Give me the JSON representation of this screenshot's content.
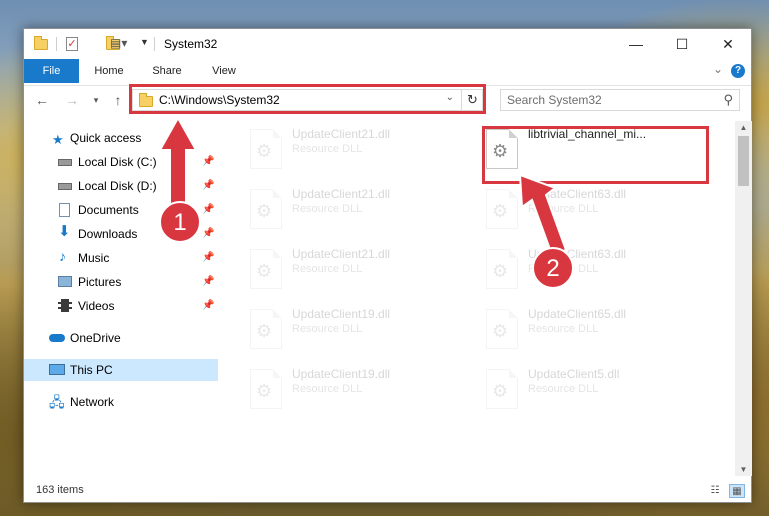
{
  "window": {
    "title": "System32",
    "min_glyph": "—",
    "max_glyph": "☐",
    "close_glyph": "✕"
  },
  "ribbon": {
    "tabs": [
      "File",
      "Home",
      "Share",
      "View"
    ],
    "help_glyph": "?",
    "collapse_glyph": "⌄"
  },
  "address": {
    "path": "C:\\Windows\\System32",
    "search_placeholder": "Search System32"
  },
  "navpane": {
    "items": [
      {
        "label": "Quick access",
        "icon": "star-icon"
      },
      {
        "label": "Local Disk (C:)",
        "icon": "drive-icon",
        "pinned": true
      },
      {
        "label": "Local Disk (D:)",
        "icon": "drive-icon",
        "pinned": true
      },
      {
        "label": "Documents",
        "icon": "documents-icon",
        "pinned": true
      },
      {
        "label": "Downloads",
        "icon": "downloads-icon",
        "pinned": true
      },
      {
        "label": "Music",
        "icon": "music-icon",
        "pinned": true
      },
      {
        "label": "Pictures",
        "icon": "pictures-icon",
        "pinned": true
      },
      {
        "label": "Videos",
        "icon": "videos-icon",
        "pinned": true
      },
      {
        "label": "OneDrive",
        "icon": "cloud-icon"
      },
      {
        "label": "This PC",
        "icon": "computer-icon",
        "selected": true
      },
      {
        "label": "Network",
        "icon": "network-icon"
      }
    ]
  },
  "files": [
    {
      "name": "UpdateClient21.dll",
      "type": "Resource DLL",
      "faded": true
    },
    {
      "name": "libtrivial_channel_mi...",
      "type": "",
      "faded": false,
      "highlighted": true
    },
    {
      "name": "UpdateClient21.dll",
      "type": "Resource DLL",
      "faded": true
    },
    {
      "name": "UpdateClient63.dll",
      "type": "Resource DLL",
      "faded": true
    },
    {
      "name": "UpdateClient21.dll",
      "type": "Resource DLL",
      "faded": true
    },
    {
      "name": "UpdateClient63.dll",
      "type": "Resource DLL",
      "faded": true
    },
    {
      "name": "UpdateClient19.dll",
      "type": "Resource DLL",
      "faded": true
    },
    {
      "name": "UpdateClient65.dll",
      "type": "Resource DLL",
      "faded": true
    },
    {
      "name": "UpdateClient19.dll",
      "type": "Resource DLL",
      "faded": true
    },
    {
      "name": "UpdateClient5.dll",
      "type": "Resource DLL",
      "faded": true
    }
  ],
  "status": {
    "item_count": "163 items"
  },
  "callouts": {
    "one": "1",
    "two": "2"
  },
  "colors": {
    "accent": "#1979ca",
    "highlight": "#d9373f",
    "selection": "#cce8ff"
  }
}
